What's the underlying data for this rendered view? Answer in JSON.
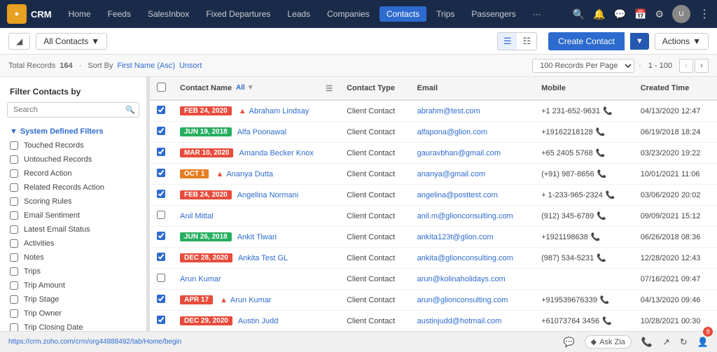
{
  "nav": {
    "logo_text": "CRM",
    "items": [
      {
        "label": "Home",
        "active": false
      },
      {
        "label": "Feeds",
        "active": false
      },
      {
        "label": "SalesInbox",
        "active": false
      },
      {
        "label": "Fixed Departures",
        "active": false
      },
      {
        "label": "Leads",
        "active": false
      },
      {
        "label": "Companies",
        "active": false
      },
      {
        "label": "Contacts",
        "active": true
      },
      {
        "label": "Trips",
        "active": false
      },
      {
        "label": "Passengers",
        "active": false
      },
      {
        "label": "···",
        "active": false
      }
    ]
  },
  "sub_nav": {
    "filter_label": "▼",
    "all_contacts": "All Contacts",
    "create_contact": "Create Contact",
    "actions": "Actions"
  },
  "records_bar": {
    "total_label": "Total Records",
    "total_count": "164",
    "sort_by": "Sort By",
    "sort_field": "First Name (Asc)",
    "unsort": "Unsort",
    "per_page": "100 Records Per Page",
    "page_range": "1 - 100"
  },
  "sidebar": {
    "title": "Filter Contacts by",
    "search_placeholder": "Search",
    "section_title": "System Defined Filters",
    "items": [
      {
        "label": "Touched Records",
        "checked": false
      },
      {
        "label": "Untouched Records",
        "checked": false
      },
      {
        "label": "Record Action",
        "checked": false
      },
      {
        "label": "Related Records Action",
        "checked": false
      },
      {
        "label": "Scoring Rules",
        "checked": false
      },
      {
        "label": "Email Sentiment",
        "checked": false
      },
      {
        "label": "Latest Email Status",
        "checked": false
      },
      {
        "label": "Activities",
        "checked": false
      },
      {
        "label": "Notes",
        "checked": false
      },
      {
        "label": "Trips",
        "checked": false
      },
      {
        "label": "Trip Amount",
        "checked": false
      },
      {
        "label": "Trip Stage",
        "checked": false
      },
      {
        "label": "Trip Owner",
        "checked": false
      },
      {
        "label": "Trip Closing Date",
        "checked": false
      }
    ]
  },
  "table": {
    "columns": [
      {
        "label": "Contact Name",
        "filter": "All"
      },
      {
        "label": "Contact Type"
      },
      {
        "label": "Email"
      },
      {
        "label": "Mobile"
      },
      {
        "label": "Created Time"
      }
    ],
    "rows": [
      {
        "tag": "FEB 24, 2020",
        "tag_color": "red",
        "flag": true,
        "name": "Abraham Lindsay",
        "type": "Client Contact",
        "email": "abrahm@test.com",
        "mobile": "+1 231-652-9631",
        "created": "04/13/2020 12:47",
        "checked": true
      },
      {
        "tag": "JUN 19, 2018",
        "tag_color": "green",
        "flag": false,
        "name": "Alfa Poonawal",
        "type": "Client Contact",
        "email": "alfapona@glion.com",
        "mobile": "+19162218128",
        "created": "06/19/2018 18:24",
        "checked": true
      },
      {
        "tag": "MAR 10, 2020",
        "tag_color": "red",
        "flag": false,
        "name": "Amanda Becker Knox",
        "type": "Client Contact",
        "email": "gauravbhan@gmail.com",
        "mobile": "+65 2405 5768",
        "created": "03/23/2020 19:22",
        "checked": true
      },
      {
        "tag": "OCT 1",
        "tag_color": "orange",
        "flag": true,
        "name": "Ananya Dutta",
        "type": "Client Contact",
        "email": "ananya@gmail.com",
        "mobile": "(+91) 987-8656",
        "created": "10/01/2021 11:06",
        "checked": true
      },
      {
        "tag": "FEB 24, 2020",
        "tag_color": "red",
        "flag": false,
        "name": "Angelina Normani",
        "type": "Client Contact",
        "email": "angelina@posttest.com",
        "mobile": "+ 1-233-965-2324",
        "created": "03/06/2020 20:02",
        "checked": true
      },
      {
        "tag": "",
        "tag_color": "",
        "flag": false,
        "name": "Anil Mittal",
        "type": "Client Contact",
        "email": "anil.m@glionconsulting.com",
        "mobile": "(912) 345-6789",
        "created": "09/09/2021 15:12",
        "checked": false
      },
      {
        "tag": "JUN 26, 2018",
        "tag_color": "green",
        "flag": false,
        "name": "Ankit Tiwari",
        "type": "Client Contact",
        "email": "ankita123t@glion.com",
        "mobile": "+1921198638",
        "created": "06/26/2018 08:36",
        "checked": true
      },
      {
        "tag": "DEC 28, 2020",
        "tag_color": "red",
        "flag": false,
        "name": "Ankita Test GL",
        "type": "Client Contact",
        "email": "ankita@glionconsulting.com",
        "mobile": "(987) 534-5231",
        "created": "12/28/2020 12:43",
        "checked": true
      },
      {
        "tag": "",
        "tag_color": "",
        "flag": false,
        "name": "Arun Kumar",
        "type": "Client Contact",
        "email": "arun@kolinaholidays.com",
        "mobile": "",
        "created": "07/16/2021 09:47",
        "checked": false
      },
      {
        "tag": "APR 17",
        "tag_color": "red",
        "flag": true,
        "name": "Arun Kumar",
        "type": "Client Contact",
        "email": "arun@glionconsulting.com",
        "mobile": "+919539676339",
        "created": "04/13/2020 09:46",
        "checked": true
      },
      {
        "tag": "DEC 29, 2020",
        "tag_color": "red",
        "flag": false,
        "name": "Austin Judd",
        "type": "Client Contact",
        "email": "austinjudd@hotmail.com",
        "mobile": "+61073764 3456",
        "created": "10/28/2021 00:30",
        "checked": true
      }
    ]
  },
  "bottom_bar": {
    "url": "https://crm.zoho.com/crm/org44888492/tab/Home/begin",
    "zia_label": "Ask Zia",
    "notification_count": "9"
  }
}
